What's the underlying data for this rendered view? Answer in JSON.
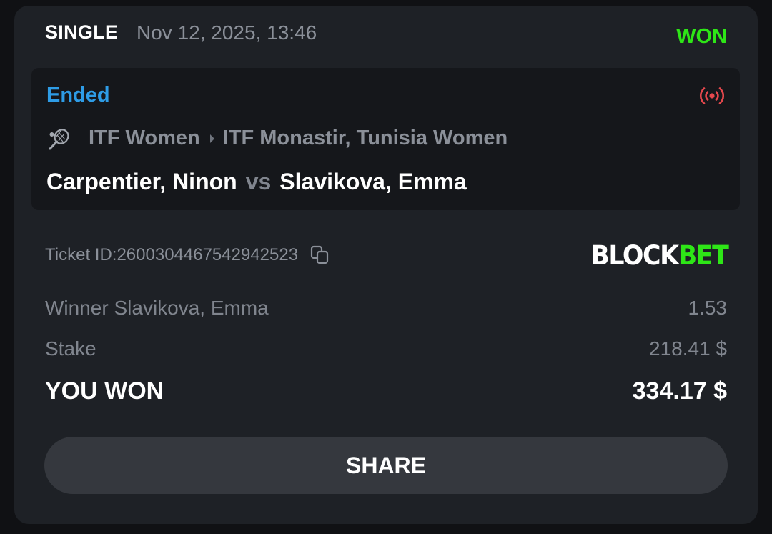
{
  "header": {
    "bet_type": "SINGLE",
    "date": "Nov 12, 2025, 13:46",
    "status": "WON"
  },
  "event": {
    "status": "Ended",
    "sport_icon": "tennis-racket-icon",
    "live_icon": "live-broadcast-icon",
    "league": "ITF Women",
    "tournament": "ITF Monastir, Tunisia Women",
    "home": "Carpentier, Ninon",
    "vs": "vs",
    "away": "Slavikova, Emma"
  },
  "ticket": {
    "label": "Ticket ID: ",
    "id": "2600304467542942523",
    "copy_icon": "copy-icon"
  },
  "brand": {
    "part1": "BLOCK",
    "part2": "BET"
  },
  "details": {
    "selection_label": "Winner Slavikova, Emma",
    "odds": "1.53",
    "stake_label": "Stake",
    "stake_value": "218.41 $",
    "won_label": "YOU WON",
    "won_value": "334.17 $"
  },
  "share_label": "SHARE",
  "colors": {
    "background": "#101114",
    "card": "#1e2126",
    "event_card": "#15171b",
    "win_green": "#2ee617",
    "ended_blue": "#2e9ce6",
    "live_red": "#e5484d",
    "button": "#35383e"
  }
}
